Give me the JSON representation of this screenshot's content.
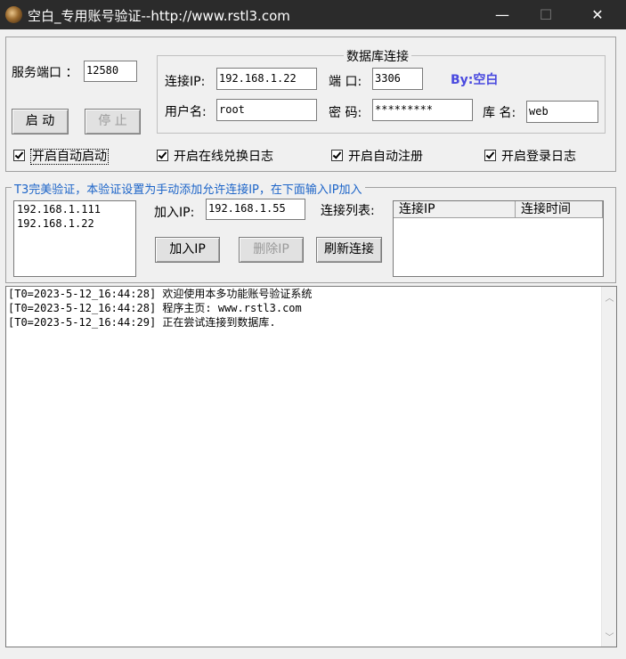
{
  "window": {
    "title": "空白_专用账号验证--http://www.rstl3.com",
    "minimize": "—",
    "maximize": "☐",
    "close": "✕"
  },
  "server": {
    "port_label": "服务端口 ：",
    "port_value": "12580",
    "start_button": "启 动",
    "stop_button": "停 止"
  },
  "db": {
    "title": "数据库连接",
    "ip_label": "连接IP:",
    "ip_value": "192.168.1.22",
    "port_label": "端 口:",
    "port_value": "3306",
    "by_text": "By:空白",
    "user_label": "用户名:",
    "user_value": "root",
    "password_label": "密 码:",
    "password_value": "*********",
    "dbname_label": "库 名:",
    "dbname_value": "web",
    "by_color": "#4a4adf"
  },
  "checkboxes": [
    {
      "label": "开启自动启动",
      "checked": true
    },
    {
      "label": "开启在线兑换日志",
      "checked": true
    },
    {
      "label": "开启自动注册",
      "checked": true
    },
    {
      "label": "开启登录日志",
      "checked": true
    }
  ],
  "t3": {
    "title": "T3完美验证，本验证设置为手动添加允许连接IP，在下面输入IP加入",
    "title_color": "#1c64c8",
    "allowed_ips": [
      "192.168.1.111",
      "192.168.1.22"
    ],
    "add_ip_label": "加入IP:",
    "add_ip_value": "192.168.1.55",
    "conn_list_label": "连接列表:",
    "add_ip_button": "加入IP",
    "delete_ip_button": "删除IP",
    "refresh_button": "刷新连接",
    "columns": [
      "连接IP",
      "连接时间"
    ]
  },
  "log": {
    "lines": [
      "[T0=2023-5-12_16:44:28] 欢迎使用本多功能账号验证系统",
      "[T0=2023-5-12_16:44:28] 程序主页: www.rstl3.com",
      "[T0=2023-5-12_16:44:29] 正在尝试连接到数据库."
    ]
  }
}
